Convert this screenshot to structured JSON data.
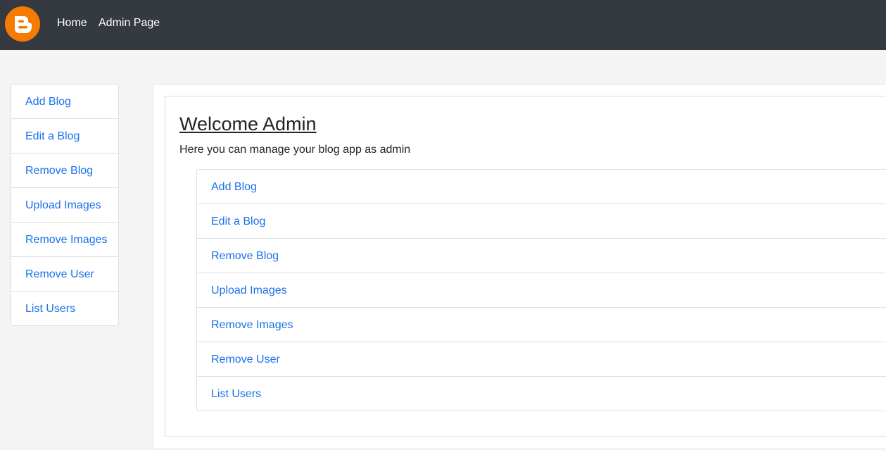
{
  "navbar": {
    "logo_icon": "blogger-logo-icon",
    "logo_color": "#f57c00",
    "links": {
      "home": "Home",
      "admin": "Admin Page"
    }
  },
  "sidebar": {
    "items": [
      {
        "label": "Add Blog"
      },
      {
        "label": "Edit a Blog"
      },
      {
        "label": "Remove Blog"
      },
      {
        "label": "Upload Images"
      },
      {
        "label": "Remove Images"
      },
      {
        "label": "Remove User"
      },
      {
        "label": "List Users"
      }
    ]
  },
  "main": {
    "title": "Welcome Admin",
    "subtitle": "Here you can manage your blog app as admin",
    "items": [
      {
        "label": "Add Blog"
      },
      {
        "label": "Edit a Blog"
      },
      {
        "label": "Remove Blog"
      },
      {
        "label": "Upload Images"
      },
      {
        "label": "Remove Images"
      },
      {
        "label": "Remove User"
      },
      {
        "label": "List Users"
      }
    ]
  },
  "colors": {
    "navbar_bg": "#343a40",
    "link": "#1a73e8",
    "page_bg": "#f4f4f4"
  }
}
